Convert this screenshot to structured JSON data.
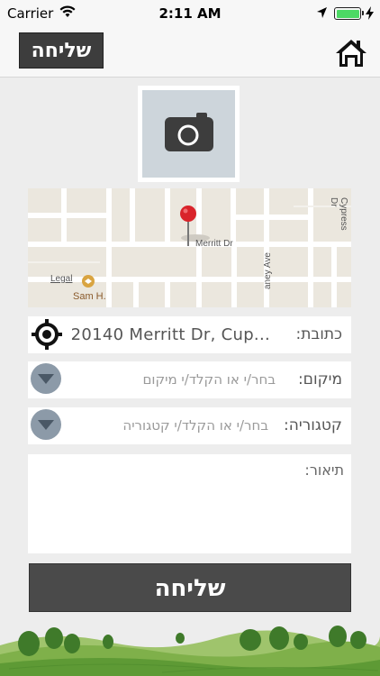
{
  "status_bar": {
    "carrier": "Carrier",
    "time": "2:11 AM",
    "battery_level": 1.0,
    "battery_color": "#4cd964"
  },
  "navbar": {
    "send_label": "שליחה",
    "home_icon": "home-icon"
  },
  "photo": {
    "icon": "camera-icon",
    "background": "#cdd5db"
  },
  "map": {
    "street_label": "Merritt Dr",
    "legal_label": "Legal",
    "place_label": "Sam H.",
    "street2_label": "aney Ave",
    "street3_label": "Cypress Dr",
    "pin_color": "#d9232a"
  },
  "form": {
    "address": {
      "label": "כתובת:",
      "value": "20140 Merritt Dr, Cup...",
      "icon": "locate-icon"
    },
    "location": {
      "label": "מיקום:",
      "placeholder": "בחר/י או הקלד/י מיקום",
      "icon": "dropdown-icon"
    },
    "category": {
      "label": "קטגוריה:",
      "placeholder": "בחר/י או הקלד/י קטגוריה",
      "icon": "dropdown-icon"
    },
    "description": {
      "label": "תיאור:"
    }
  },
  "submit": {
    "label": "שליחה"
  }
}
